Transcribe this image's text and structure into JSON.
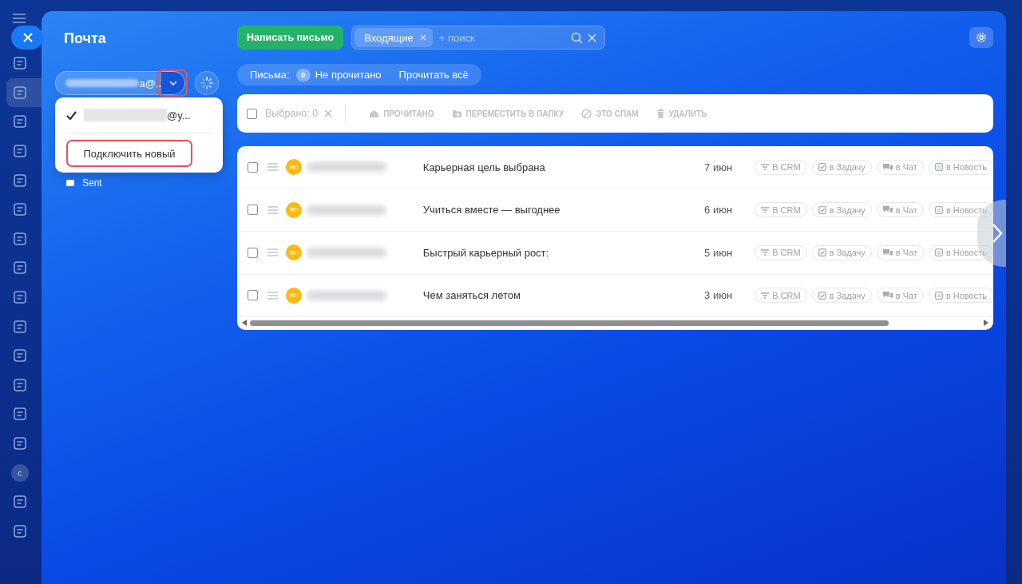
{
  "app_sidebar": {
    "items": [
      {
        "kind": "icon",
        "selected": false
      },
      {
        "kind": "icon",
        "selected": true
      },
      {
        "kind": "icon",
        "selected": false
      },
      {
        "kind": "icon",
        "selected": false
      },
      {
        "kind": "icon",
        "selected": false
      },
      {
        "kind": "icon",
        "selected": false
      },
      {
        "kind": "icon",
        "selected": false
      },
      {
        "kind": "icon",
        "selected": false
      },
      {
        "kind": "icon",
        "selected": false
      },
      {
        "kind": "icon",
        "selected": false
      },
      {
        "kind": "icon",
        "selected": false
      },
      {
        "kind": "icon",
        "selected": false
      },
      {
        "kind": "icon",
        "selected": false
      },
      {
        "kind": "icon",
        "selected": false
      },
      {
        "kind": "avatar",
        "avatar": "с",
        "selected": false
      },
      {
        "kind": "icon",
        "selected": false
      },
      {
        "kind": "icon",
        "selected": false
      }
    ]
  },
  "panel": {
    "title": "Почта",
    "account": {
      "value": "a@.."
    },
    "dropdown": {
      "accounts": [
        {
          "value": "@y...",
          "selected": true
        }
      ],
      "connect_label": "Подключить новый"
    },
    "folders": [
      {
        "label": "Sent"
      }
    ]
  },
  "toolbar": {
    "compose": "Написать письмо",
    "filter_tag": "Входящие",
    "search_placeholder": "+ поиск"
  },
  "counter": {
    "label": "Письма:",
    "count": "0",
    "unread": "Не прочитано",
    "read_all": "Прочитать всё"
  },
  "bulk_actions": {
    "checked": false,
    "selected": "Выбрано: 0",
    "buttons": [
      {
        "label": "ПРОЧИТАНО",
        "kind": "read"
      },
      {
        "label": "ПЕРЕМЕСТИТЬ В ПАПКУ",
        "kind": "move"
      },
      {
        "label": "ЭТО СПАМ",
        "kind": "spam"
      },
      {
        "label": "УДАЛИТЬ",
        "kind": "delete"
      }
    ]
  },
  "messages": [
    {
      "checked": false,
      "avatar": "ЯП",
      "subject": "Карьерная цель выбрана",
      "date": "7 июн",
      "actions": [
        {
          "label": "В CRM",
          "kind": "crm"
        },
        {
          "label": "в Задачу",
          "kind": "task"
        },
        {
          "label": "в Чат",
          "kind": "chat"
        },
        {
          "label": "в Новость",
          "kind": "news"
        }
      ]
    },
    {
      "checked": false,
      "avatar": "ЯП",
      "subject": "Учиться вместе — выгоднее",
      "date": "6 июн",
      "actions": [
        {
          "label": "В CRM",
          "kind": "crm"
        },
        {
          "label": "в Задачу",
          "kind": "task"
        },
        {
          "label": "в Чат",
          "kind": "chat"
        },
        {
          "label": "в Новость",
          "kind": "news"
        }
      ]
    },
    {
      "checked": false,
      "avatar": "ЯП",
      "subject": "Быстрый карьерный рост:",
      "date": "5 июн",
      "actions": [
        {
          "label": "В CRM",
          "kind": "crm"
        },
        {
          "label": "в Задачу",
          "kind": "task"
        },
        {
          "label": "в Чат",
          "kind": "chat"
        },
        {
          "label": "в Новость",
          "kind": "news"
        }
      ]
    },
    {
      "checked": false,
      "avatar": "ЯП",
      "subject": "Чем заняться летом",
      "date": "3 июн",
      "actions": [
        {
          "label": "В CRM",
          "kind": "crm"
        },
        {
          "label": "в Задачу",
          "kind": "task"
        },
        {
          "label": "в Чат",
          "kind": "chat"
        },
        {
          "label": "в Новость",
          "kind": "news"
        }
      ]
    }
  ]
}
